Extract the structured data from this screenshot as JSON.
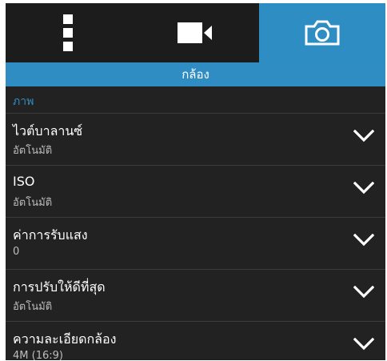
{
  "tabs": {
    "menu_icon": "more-vertical-icon",
    "video_icon": "video-camera-icon",
    "camera_icon": "camera-icon",
    "active": "camera"
  },
  "header": {
    "title": "กล้อง"
  },
  "section": {
    "label": "ภาพ"
  },
  "settings": [
    {
      "label": "ไวต์บาลานซ์",
      "value": "อัตโนมัติ"
    },
    {
      "label": "ISO",
      "value": "อัตโนมัติ"
    },
    {
      "label": "ค่าการรับแสง",
      "value": "0"
    },
    {
      "label": "การปรับให้ดีที่สุด",
      "value": "อัตโนมัติ"
    },
    {
      "label": "ความละเอียดกล้อง",
      "value": "4M (16:9)"
    }
  ],
  "colors": {
    "accent": "#2f8dc4",
    "background": "#222222",
    "text_primary": "#ffffff",
    "text_secondary": "#bdbdbd"
  }
}
